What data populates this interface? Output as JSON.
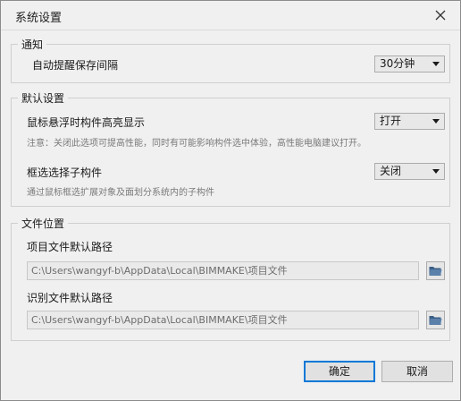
{
  "window": {
    "title": "系统设置"
  },
  "notify": {
    "legend": "通知",
    "autosave_label": "自动提醒保存间隔",
    "autosave_value": "30分钟"
  },
  "defaults": {
    "legend": "默认设置",
    "hover_label": "鼠标悬浮时构件高亮显示",
    "hover_value": "打开",
    "hover_hint": "注意：关闭此选项可提高性能，同时有可能影响构件选中体验，高性能电脑建议打开。",
    "subselect_label": "框选选择子构件",
    "subselect_value": "关闭",
    "subselect_hint": "通过鼠标框选扩展对象及面划分系统内的子构件"
  },
  "file_location": {
    "legend": "文件位置",
    "project_label": "项目文件默认路径",
    "project_path": "C:\\Users\\wangyf-b\\AppData\\Local\\BIMMAKE\\项目文件",
    "recognize_label": "识别文件默认路径",
    "recognize_path": "C:\\Users\\wangyf-b\\AppData\\Local\\BIMMAKE\\项目文件"
  },
  "buttons": {
    "ok": "确定",
    "cancel": "取消"
  },
  "icons": {
    "close": "close-icon",
    "folder": "folder-icon",
    "dropdown": "chevron-down-icon"
  },
  "colors": {
    "folder": "#3b5f86",
    "accent": "#0078d7"
  }
}
